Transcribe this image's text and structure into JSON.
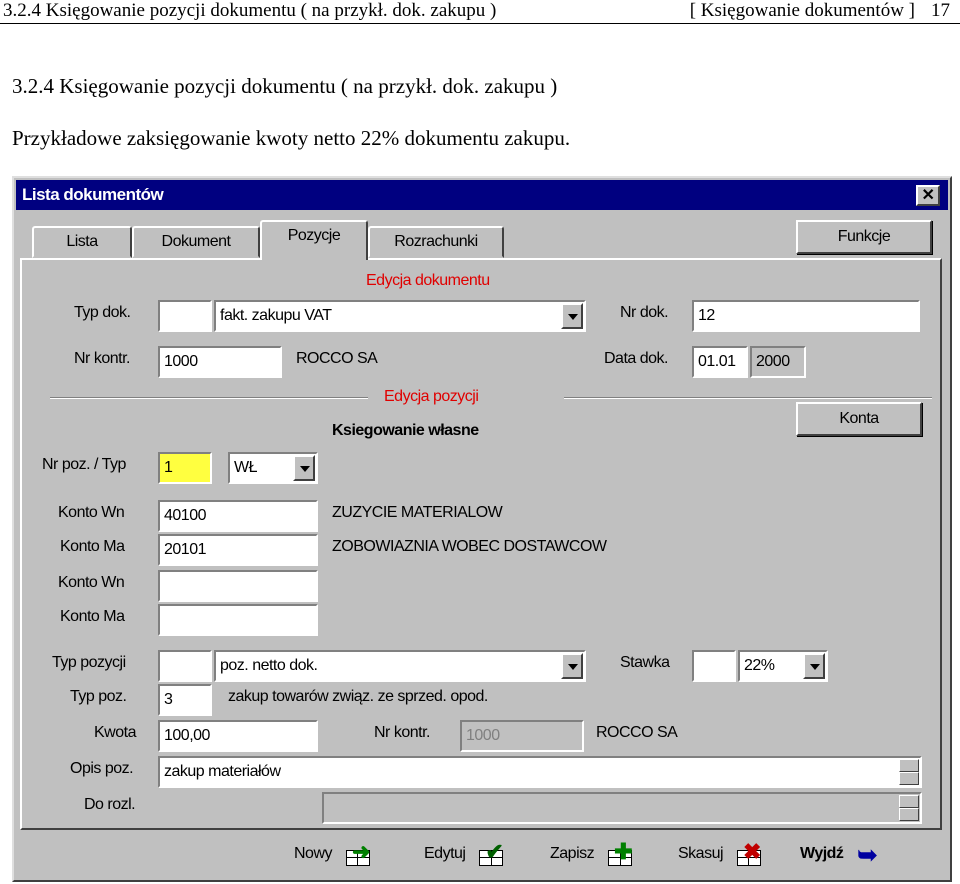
{
  "doc": {
    "header_left": "3.2.4 Księgowanie pozycji dokumentu ( na przykł. dok. zakupu )",
    "header_right": "[ Księgowanie dokumentów ]",
    "page_number": "17",
    "heading": "3.2.4 Księgowanie pozycji dokumentu ( na przykł. dok. zakupu )",
    "caption": "Przykładowe zaksięgowanie kwoty netto 22% dokumentu zakupu."
  },
  "window": {
    "title": "Lista dokumentów",
    "close": "✕",
    "tabs": [
      "Lista",
      "Dokument",
      "Pozycje",
      "Rozrachunki"
    ],
    "active_tab": "Pozycje",
    "functions_button": "Funkcje"
  },
  "document": {
    "section_title": "Edycja dokumentu",
    "typ_dok_label": "Typ dok.",
    "typ_dok_code": "",
    "typ_dok_value": "fakt. zakupu VAT",
    "nr_dok_label": "Nr dok.",
    "nr_dok_value": "12",
    "nr_kontr_label": "Nr kontr.",
    "nr_kontr_value": "1000",
    "kontr_name": "ROCCO SA",
    "data_dok_label": "Data dok.",
    "data_dok_value": "01.01",
    "data_dok_year": "2000"
  },
  "position": {
    "section_title": "Edycja pozycji",
    "konta_button": "Konta",
    "subtitle": "Ksiegowanie własne",
    "nr_poz_label": "Nr poz. / Typ",
    "nr_poz_value": "1",
    "typ_value": "WŁ",
    "konto_wn_label": "Konto Wn",
    "konto_wn_value": "40100",
    "konto_wn_desc": "ZUZYCIE MATERIALOW",
    "konto_ma_label": "Konto Ma",
    "konto_ma_value": "20101",
    "konto_ma_desc": "ZOBOWIAZNIA WOBEC DOSTAWCOW",
    "konto_wn2_label": "Konto Wn",
    "konto_wn2_value": "",
    "konto_ma2_label": "Konto Ma",
    "konto_ma2_value": "",
    "typ_pozycji_label": "Typ pozycji",
    "typ_pozycji_code": "",
    "typ_pozycji_value": "poz. netto dok.",
    "stawka_label": "Stawka",
    "stawka_code": "",
    "stawka_value": "22%",
    "typ_poz_label": "Typ poz.",
    "typ_poz_value": "3",
    "typ_poz_desc": "zakup towarów związ. ze sprzed. opod.",
    "kwota_label": "Kwota",
    "kwota_value": "100,00",
    "nr_kontr_label": "Nr kontr.",
    "nr_kontr_value": "1000",
    "kontr_name": "ROCCO SA",
    "opis_label": "Opis poz.",
    "opis_value": "zakup materiałów",
    "do_rozl_label": "Do rozl.",
    "do_rozl_value": ""
  },
  "actions": {
    "new": "Nowy",
    "edit": "Edytuj",
    "save": "Zapisz",
    "delete": "Skasuj",
    "exit": "Wyjdź"
  }
}
